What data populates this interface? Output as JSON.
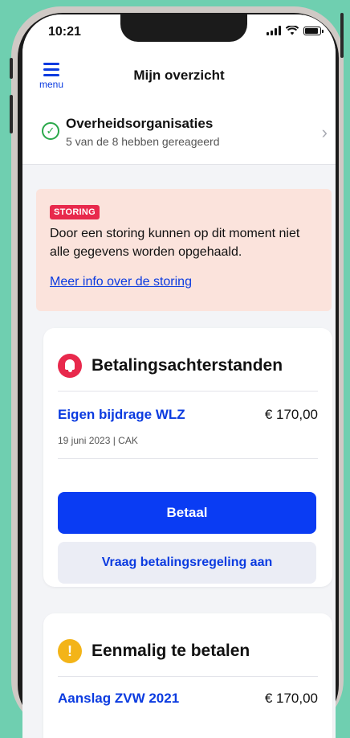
{
  "status_bar": {
    "time": "10:21"
  },
  "header": {
    "menu_label": "menu",
    "title": "Mijn overzicht"
  },
  "organisations": {
    "title": "Overheidsorganisaties",
    "subtitle": "5 van de 8 hebben gereageerd"
  },
  "alert": {
    "badge": "STORING",
    "message": "Door een storing kunnen op dit moment niet alle gegevens worden opgehaald.",
    "link": "Meer info over de storing"
  },
  "arrears_card": {
    "title": "Betalingsachterstanden",
    "item": {
      "title": "Eigen bijdrage WLZ",
      "amount": "€ 170,00",
      "meta": "19 juni 2023  |  CAK"
    },
    "pay_button": "Betaal",
    "arrangement_button": "Vraag betalingsregeling aan"
  },
  "onetime_card": {
    "title": "Eenmalig te betalen",
    "item": {
      "title": "Aanslag ZVW 2021",
      "amount": "€ 170,00"
    }
  },
  "colors": {
    "accent": "#0a3cf3",
    "alert_bg": "#fbe3dc",
    "badge": "#e8294c",
    "warning": "#f3b418",
    "success": "#2aa84a"
  }
}
